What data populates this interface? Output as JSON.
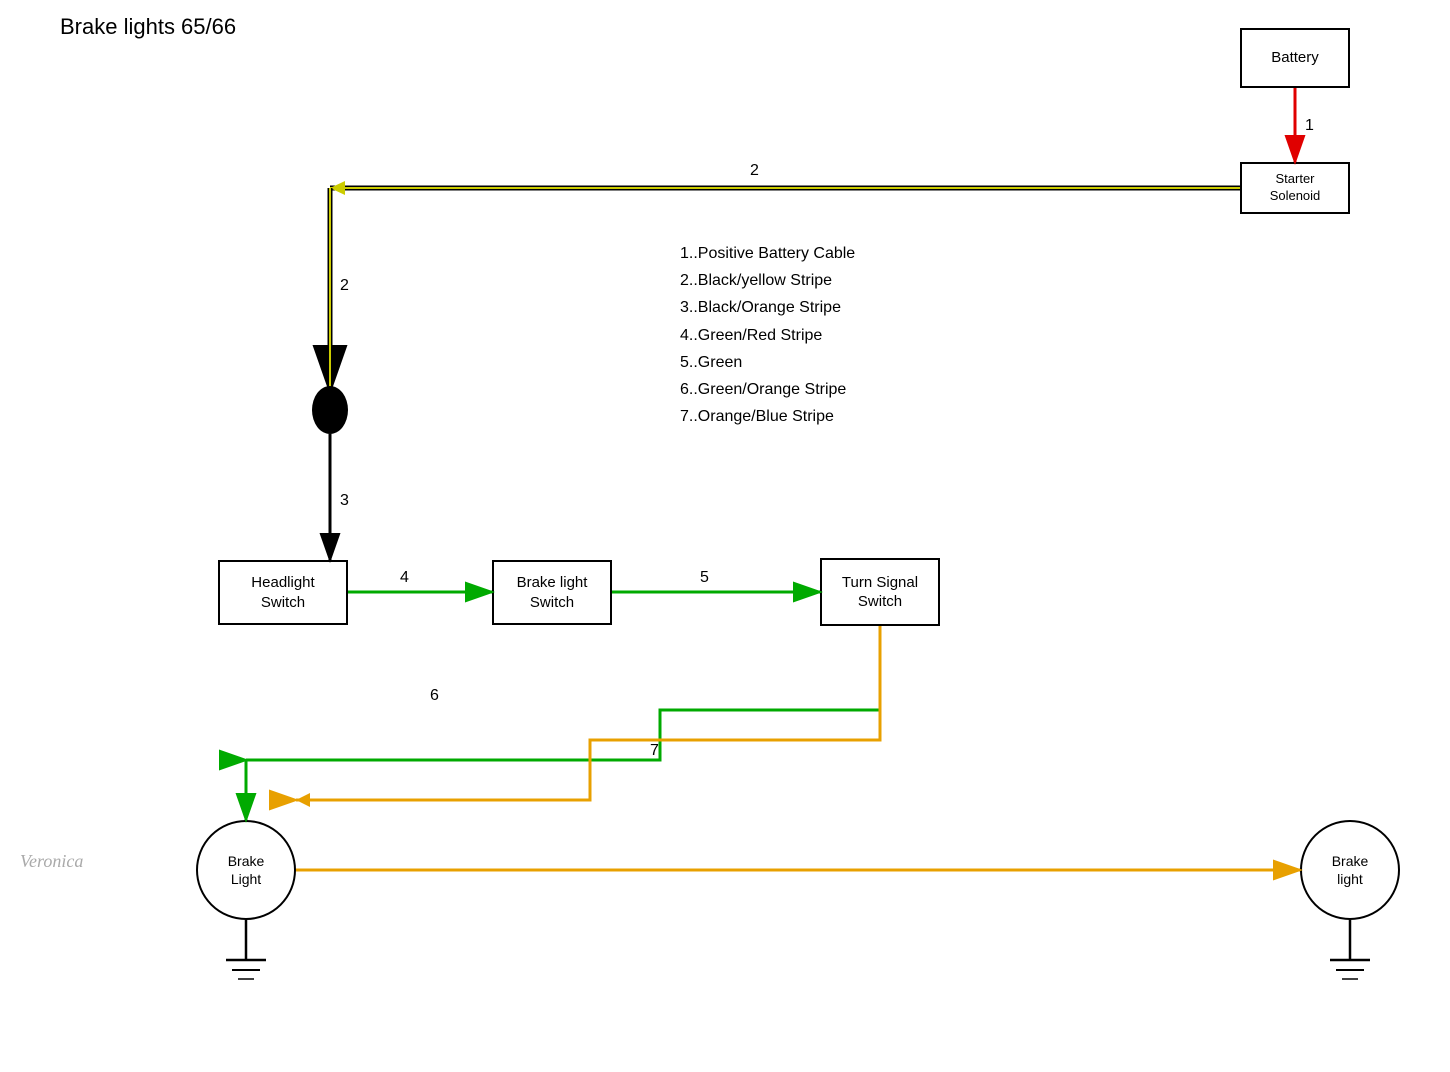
{
  "title": "Brake lights 65/66",
  "legend": {
    "items": [
      "1..Positive Battery Cable",
      "2..Black/yellow Stripe",
      "3..Black/Orange Stripe",
      "4..Green/Red Stripe",
      "5..Green",
      "6..Green/Orange Stripe",
      "7..Orange/Blue Stripe"
    ]
  },
  "components": {
    "battery": "Battery",
    "starter_solenoid": "Starter\nSolenoid",
    "headlight_switch": "Headlight\nSwitch",
    "brake_light_switch": "Brake light\nSwitch",
    "turn_signal_switch": "Turn Signal\nSwitch",
    "brake_light_left": "Brake\nLight",
    "brake_light_right": "Brake\nlight"
  },
  "wire_labels": {
    "w1": "1",
    "w2a": "2",
    "w2b": "2",
    "w3": "3",
    "w4": "4",
    "w5": "5",
    "w6": "6",
    "w7": "7"
  },
  "watermark": "Veronica",
  "colors": {
    "red": "#e00000",
    "black_yellow": "#cccc00",
    "black": "#000000",
    "green": "#00aa00",
    "orange": "#e8a000"
  }
}
